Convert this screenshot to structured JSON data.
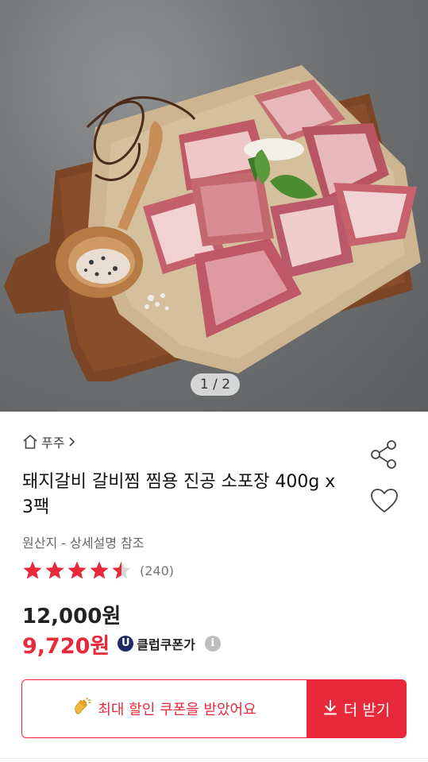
{
  "gallery": {
    "image_alt": "돼지갈비 제품 사진",
    "pager": "1 / 2"
  },
  "breadcrumb": {
    "category": "푸주",
    "home_icon": "home-icon",
    "chevron_icon": "chevron-right-icon"
  },
  "actions": {
    "share_icon": "share-icon",
    "wishlist_icon": "heart-icon"
  },
  "product": {
    "title": "돼지갈비 갈비찜 찜용 진공 소포장 400g x 3팩",
    "origin": "원산지 - 상세설명 참조",
    "rating": 4.5,
    "review_count": "(240)"
  },
  "price": {
    "original": "12,000원",
    "sale": "9,720원",
    "club_badge": "U",
    "club_label": "클럽쿠폰가",
    "info_icon": "i"
  },
  "coupon": {
    "message": "최대 할인 쿠폰을 받았어요",
    "emoji": "clapping-hands-icon",
    "more_label": "더 받기",
    "download_icon": "download-icon"
  },
  "colors": {
    "accent": "#e8283b",
    "club_badge": "#1f2c64",
    "star": "#e8283b"
  }
}
